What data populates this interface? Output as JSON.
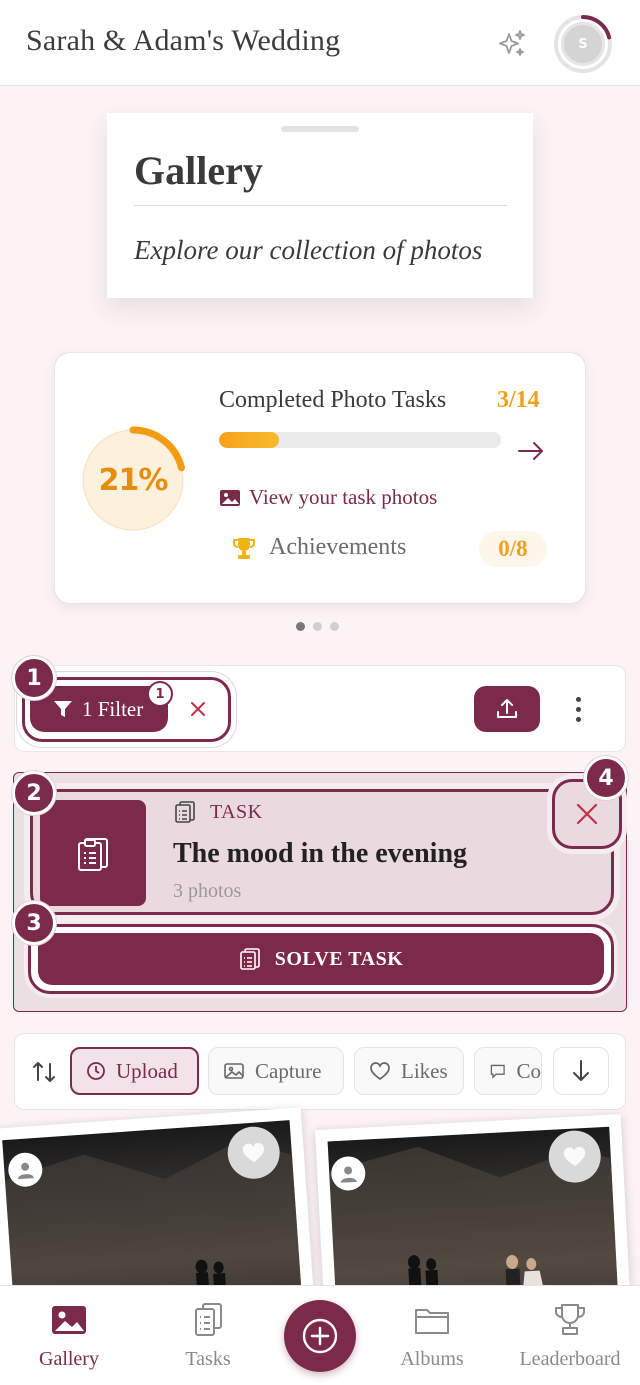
{
  "header": {
    "title": "Sarah & Adam's Wedding",
    "sparkle_icon": "sparkle-icon",
    "avatar_initial": "S"
  },
  "gallery_card": {
    "title": "Gallery",
    "subtitle": "Explore our collection of photos"
  },
  "progress": {
    "percent_label": "21%",
    "percent": 21,
    "tasks_label": "Completed Photo Tasks",
    "tasks_count": "3/14",
    "tasks_done": 3,
    "tasks_total": 14,
    "view_photos_label": "View your task photos",
    "achievements_label": "Achievements",
    "achievements_count": "0/8",
    "carousel_pages": 3,
    "carousel_active": 0
  },
  "filter_bar": {
    "filter_label": "1 Filter",
    "filter_badge": "1"
  },
  "task": {
    "type_label": "TASK",
    "title": "The mood in the evening",
    "photos": "3 photos",
    "solve_label": "SOLVE TASK"
  },
  "steps": [
    "1",
    "2",
    "3",
    "4"
  ],
  "sort_bar": {
    "chips": [
      {
        "label": "Upload",
        "icon": "clock-icon",
        "active": true
      },
      {
        "label": "Capture",
        "icon": "image-icon",
        "active": false
      },
      {
        "label": "Likes",
        "icon": "heart-icon",
        "active": false
      },
      {
        "label": "Co",
        "icon": "comment-icon",
        "active": false
      }
    ]
  },
  "bottom_nav": {
    "items": [
      {
        "label": "Gallery",
        "icon": "gallery-icon",
        "active": true
      },
      {
        "label": "Tasks",
        "icon": "clipboard-icon",
        "active": false
      },
      {
        "label": "Albums",
        "icon": "folder-icon",
        "active": false
      },
      {
        "label": "Leaderboard",
        "icon": "trophy-icon",
        "active": false
      }
    ],
    "fab_icon": "plus-icon"
  },
  "colors": {
    "brand": "#7b2a4b",
    "accent": "#f0a020",
    "background": "#fbf3f4"
  }
}
